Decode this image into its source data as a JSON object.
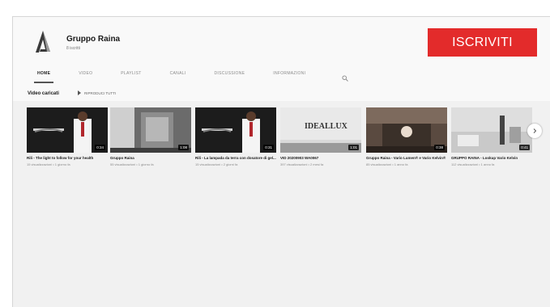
{
  "channel": {
    "name": "Gruppo Raina",
    "subscribers": "8 iscritti",
    "subscribe_label": "ISCRIVITI",
    "accent_color": "#e32b2b"
  },
  "tabs": [
    {
      "label": "Home",
      "active": true
    },
    {
      "label": "Video",
      "active": false
    },
    {
      "label": "Playlist",
      "active": false
    },
    {
      "label": "Canali",
      "active": false
    },
    {
      "label": "Discussione",
      "active": false
    },
    {
      "label": "Informazioni",
      "active": false
    }
  ],
  "section": {
    "title": "Video caricati",
    "play_all_label": "Riproduci tutti"
  },
  "videos": [
    {
      "title": "Rili - The light to follow for your health",
      "meta": "15 visualizzazioni • 1 giorno fa",
      "duration": "0:34"
    },
    {
      "title": "Gruppo Raina",
      "meta": "55 visualizzazioni • 1 giorno fa",
      "duration": "1:08"
    },
    {
      "title": "Rili - La lampada da terra con dosatore di gel...",
      "meta": "15 visualizzazioni • 2 giorni fa",
      "duration": "0:31"
    },
    {
      "title": "VID 20200903 WA0067",
      "meta": "397 visualizzazioni • 2 mesi fa",
      "duration": "1:01"
    },
    {
      "title": "Gruppo Raina - Vario Lumen® e Vario Kelvin®",
      "meta": "85 visualizzazioni • 1 anno fa",
      "duration": "0:38"
    },
    {
      "title": "GRUPPO RAINA - Lookup Vario Kelvin",
      "meta": "112 visualizzazioni • 1 anno fa",
      "duration": "0:41"
    }
  ]
}
